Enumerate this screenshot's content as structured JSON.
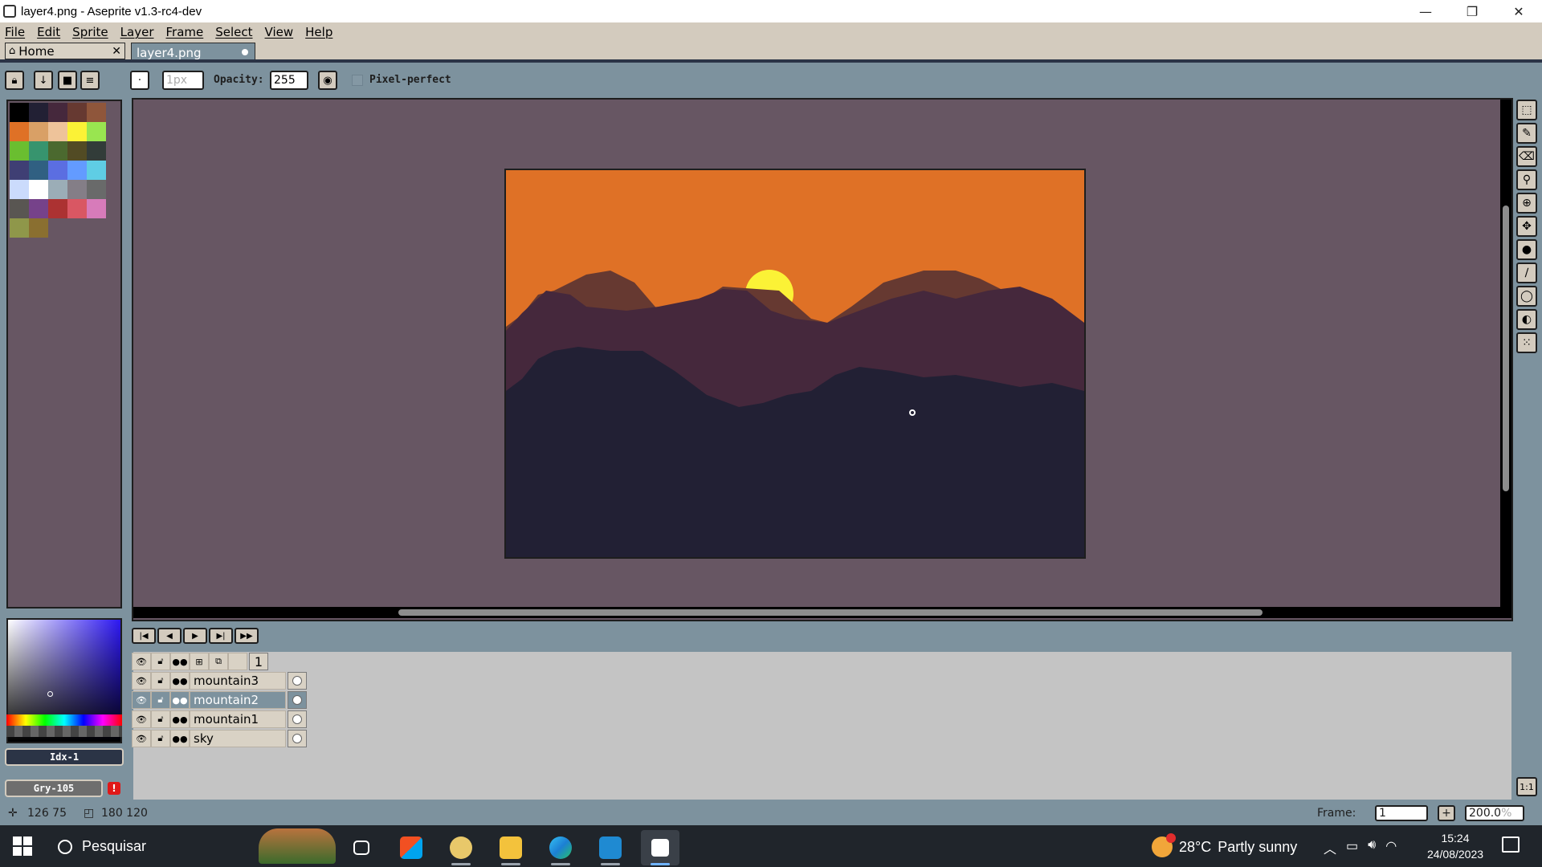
{
  "window": {
    "title": "layer4.png - Aseprite v1.3-rc4-dev",
    "minimize": "—",
    "maximize": "❐",
    "close": "✕"
  },
  "menu": [
    "File",
    "Edit",
    "Sprite",
    "Layer",
    "Frame",
    "Select",
    "View",
    "Help"
  ],
  "tabs": {
    "home": {
      "label": "Home",
      "close": "✕"
    },
    "file": {
      "label": "layer4.png"
    }
  },
  "toolbar": {
    "brush_size_placeholder": "1px",
    "opacity_label": "Opacity:",
    "opacity_value": "255",
    "pixel_perfect_label": "Pixel-perfect"
  },
  "palette": {
    "colors": [
      "#000000",
      "#222034",
      "#45283c",
      "#663931",
      "#8f563b",
      "#df7126",
      "#d9a066",
      "#eec39a",
      "#fbf236",
      "#99e550",
      "#6abe30",
      "#37946e",
      "#4b692f",
      "#524b24",
      "#323c39",
      "#3f3f74",
      "#306082",
      "#5b6ee1",
      "#639bff",
      "#5fcde4",
      "#cbdbfc",
      "#ffffff",
      "#9badb7",
      "#847e87",
      "#696a6a",
      "#595652",
      "#76428a",
      "#ac3232",
      "#d95763",
      "#d77bba",
      "#8f974a",
      "#8a6f30"
    ]
  },
  "color_panel": {
    "index_label": "Idx-1",
    "gray_label": "Gry-105",
    "warning": "!"
  },
  "sprite_colors": {
    "sky": "#df7126",
    "sun": "#fbf236",
    "mountain1": "#663931",
    "mountain2": "#45283c",
    "mountain3": "#222034"
  },
  "timeline": {
    "frame_header": "1",
    "layers": [
      {
        "name": "mountain3",
        "selected": false
      },
      {
        "name": "mountain2",
        "selected": true
      },
      {
        "name": "mountain1",
        "selected": false
      },
      {
        "name": "sky",
        "selected": false
      }
    ]
  },
  "status": {
    "cursor_pos": "126  75",
    "sprite_size": "180  120",
    "frame_label": "Frame:",
    "frame_value": "1",
    "zoom_value": "200.0",
    "zoom_unit": "%"
  },
  "taskbar": {
    "search_label": "Pesquisar",
    "weather_temp": "28°C",
    "weather_text": "Partly sunny",
    "time": "15:24",
    "date": "24/08/2023",
    "tray_icons": [
      "chevron-up-icon",
      "battery-icon",
      "volume-icon",
      "wifi-icon"
    ]
  }
}
